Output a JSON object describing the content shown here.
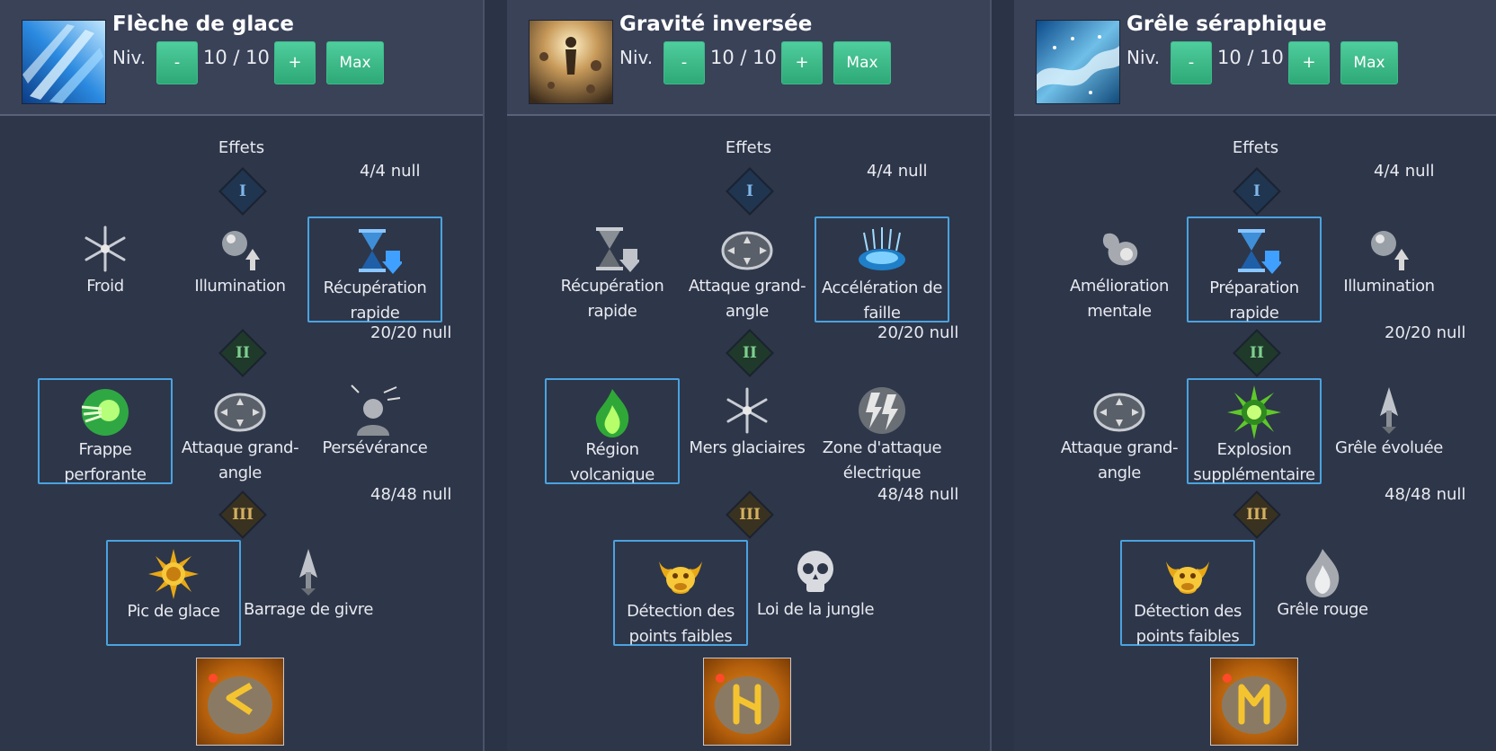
{
  "panels": [
    {
      "title": "Flèche de glace",
      "level_label": "Niv.",
      "level_value": "10 / 10",
      "minus": "-",
      "plus": "+",
      "max": "Max",
      "effects_label": "Effets",
      "tiers": [
        {
          "numeral": "I",
          "count": "4/4 null",
          "nodes": [
            {
              "label": "Froid",
              "icon": "snowflake-icon",
              "selected": false
            },
            {
              "label": "Illumination",
              "icon": "orb-up-icon",
              "selected": false
            },
            {
              "label": "Récupération rapide",
              "icon": "hourglass-down-icon",
              "selected": true
            }
          ]
        },
        {
          "numeral": "II",
          "count": "20/20 null",
          "nodes": [
            {
              "label": "Frappe perforante",
              "icon": "piercing-orb-icon",
              "selected": true
            },
            {
              "label": "Attaque grand-angle",
              "icon": "wide-angle-icon",
              "selected": false
            },
            {
              "label": "Persévérance",
              "icon": "head-lightning-icon",
              "selected": false
            }
          ]
        },
        {
          "numeral": "III",
          "count": "48/48 null",
          "nodes": [
            {
              "label": "Pic de glace",
              "icon": "sun-icon",
              "selected": true
            },
            {
              "label": "Barrage de givre",
              "icon": "arrowhead-icon",
              "selected": false
            }
          ]
        }
      ],
      "rune_icon": "rune-c-icon"
    },
    {
      "title": "Gravité inversée",
      "level_label": "Niv.",
      "level_value": "10 / 10",
      "minus": "-",
      "plus": "+",
      "max": "Max",
      "effects_label": "Effets",
      "tiers": [
        {
          "numeral": "I",
          "count": "4/4 null",
          "nodes": [
            {
              "label": "Récupération rapide",
              "icon": "hourglass-down-icon",
              "selected": false
            },
            {
              "label": "Attaque grand-angle",
              "icon": "wide-angle-icon",
              "selected": false
            },
            {
              "label": "Accélération de faille",
              "icon": "rift-splash-icon",
              "selected": true
            }
          ]
        },
        {
          "numeral": "II",
          "count": "20/20 null",
          "nodes": [
            {
              "label": "Région volcanique",
              "icon": "green-flame-icon",
              "selected": true
            },
            {
              "label": "Mers glaciaires",
              "icon": "snowflake-icon",
              "selected": false
            },
            {
              "label": "Zone d'attaque électrique",
              "icon": "lightning-icon",
              "selected": false
            }
          ]
        },
        {
          "numeral": "III",
          "count": "48/48 null",
          "nodes": [
            {
              "label": "Détection des points faibles",
              "icon": "bull-mask-icon",
              "selected": true
            },
            {
              "label": "Loi de la jungle",
              "icon": "skull-icon",
              "selected": false
            }
          ]
        }
      ],
      "rune_icon": "rune-h-icon"
    },
    {
      "title": "Grêle séraphique",
      "level_label": "Niv.",
      "level_value": "10 / 10",
      "minus": "-",
      "plus": "+",
      "max": "Max",
      "effects_label": "Effets",
      "tiers": [
        {
          "numeral": "I",
          "count": "4/4 null",
          "nodes": [
            {
              "label": "Amélioration mentale",
              "icon": "mental-icon",
              "selected": false
            },
            {
              "label": "Préparation rapide",
              "icon": "hourglass-down-icon",
              "selected": true
            },
            {
              "label": "Illumination",
              "icon": "orb-up-icon",
              "selected": false
            }
          ]
        },
        {
          "numeral": "II",
          "count": "20/20 null",
          "nodes": [
            {
              "label": "Attaque grand-angle",
              "icon": "wide-angle-icon",
              "selected": false
            },
            {
              "label": "Explosion supplémentaire",
              "icon": "burst-icon",
              "selected": true
            },
            {
              "label": "Grêle évoluée",
              "icon": "arrowhead-icon",
              "selected": false
            }
          ]
        },
        {
          "numeral": "III",
          "count": "48/48 null",
          "nodes": [
            {
              "label": "Détection des points faibles",
              "icon": "bull-mask-icon",
              "selected": true
            },
            {
              "label": "Grêle rouge",
              "icon": "flame-icon",
              "selected": false
            }
          ]
        }
      ],
      "rune_icon": "rune-m-icon"
    }
  ]
}
